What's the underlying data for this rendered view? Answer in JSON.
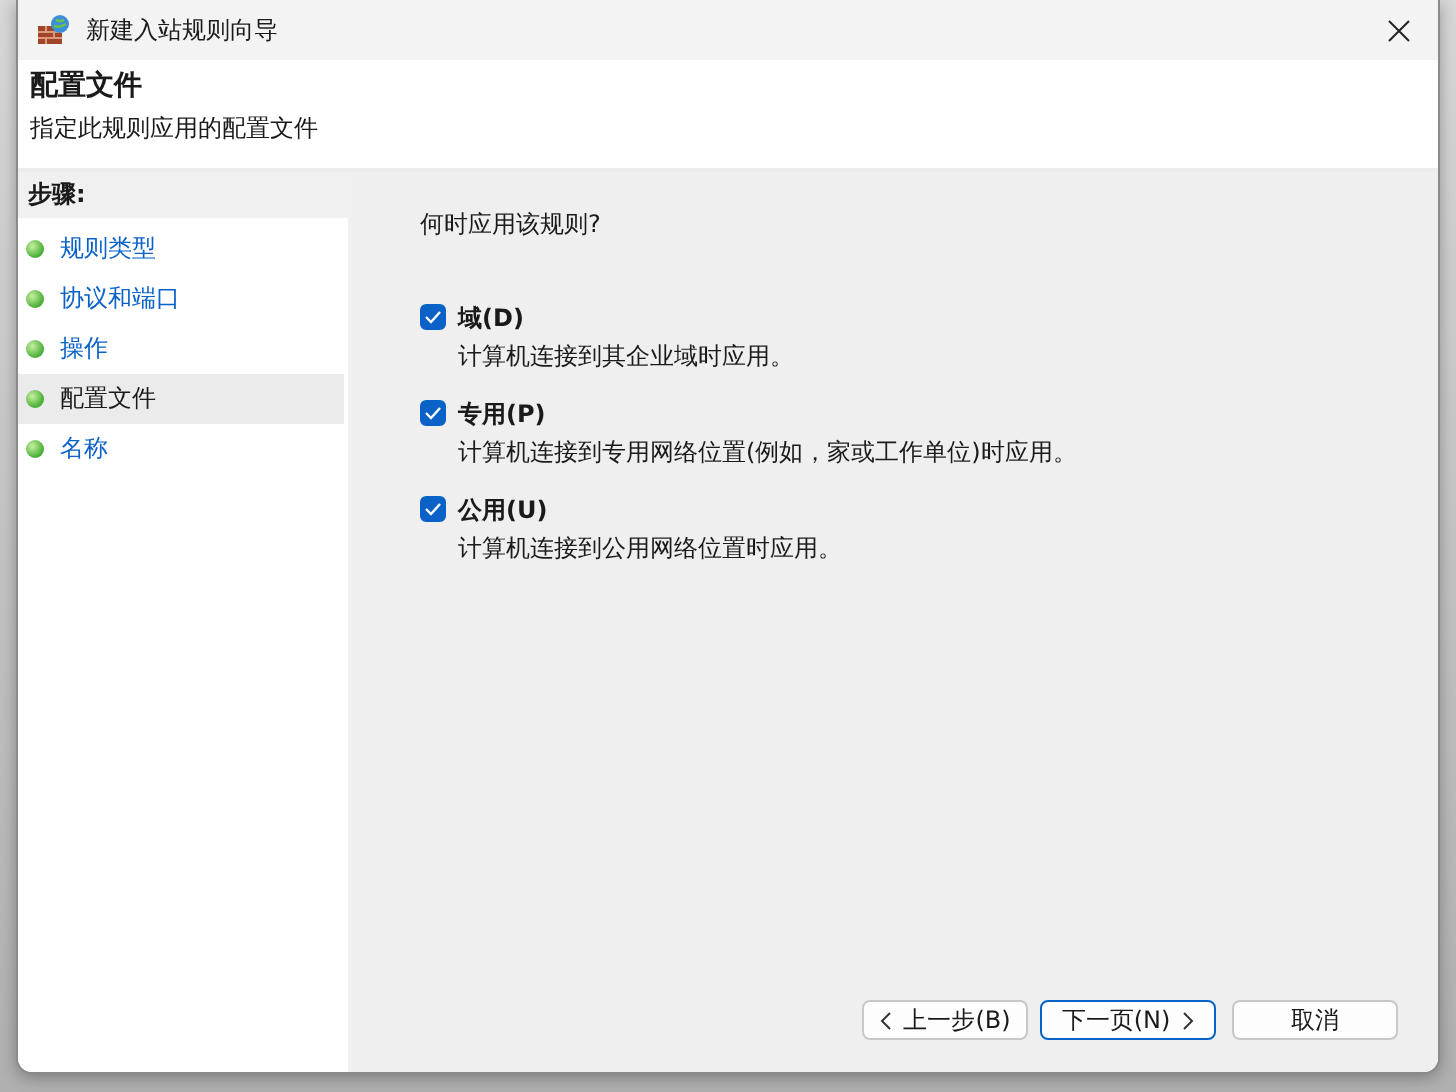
{
  "window": {
    "title": "新建入站规则向导"
  },
  "header": {
    "title": "配置文件",
    "subtitle": "指定此规则应用的配置文件"
  },
  "sidebar": {
    "heading": "步骤:",
    "items": [
      {
        "label": "规则类型",
        "selected": false
      },
      {
        "label": "协议和端口",
        "selected": false
      },
      {
        "label": "操作",
        "selected": false
      },
      {
        "label": "配置文件",
        "selected": true
      },
      {
        "label": "名称",
        "selected": false
      }
    ]
  },
  "content": {
    "question": "何时应用该规则?",
    "options": [
      {
        "label": "域(D)",
        "description": "计算机连接到其企业域时应用。",
        "checked": true
      },
      {
        "label": "专用(P)",
        "description": "计算机连接到专用网络位置(例如，家或工作单位)时应用。",
        "checked": true
      },
      {
        "label": "公用(U)",
        "description": "计算机连接到公用网络位置时应用。",
        "checked": true
      }
    ]
  },
  "buttons": [
    {
      "label": "上一步(B)",
      "kind": "back"
    },
    {
      "label": "下一页(N)",
      "kind": "next"
    },
    {
      "label": "取消",
      "kind": "plain"
    }
  ]
}
